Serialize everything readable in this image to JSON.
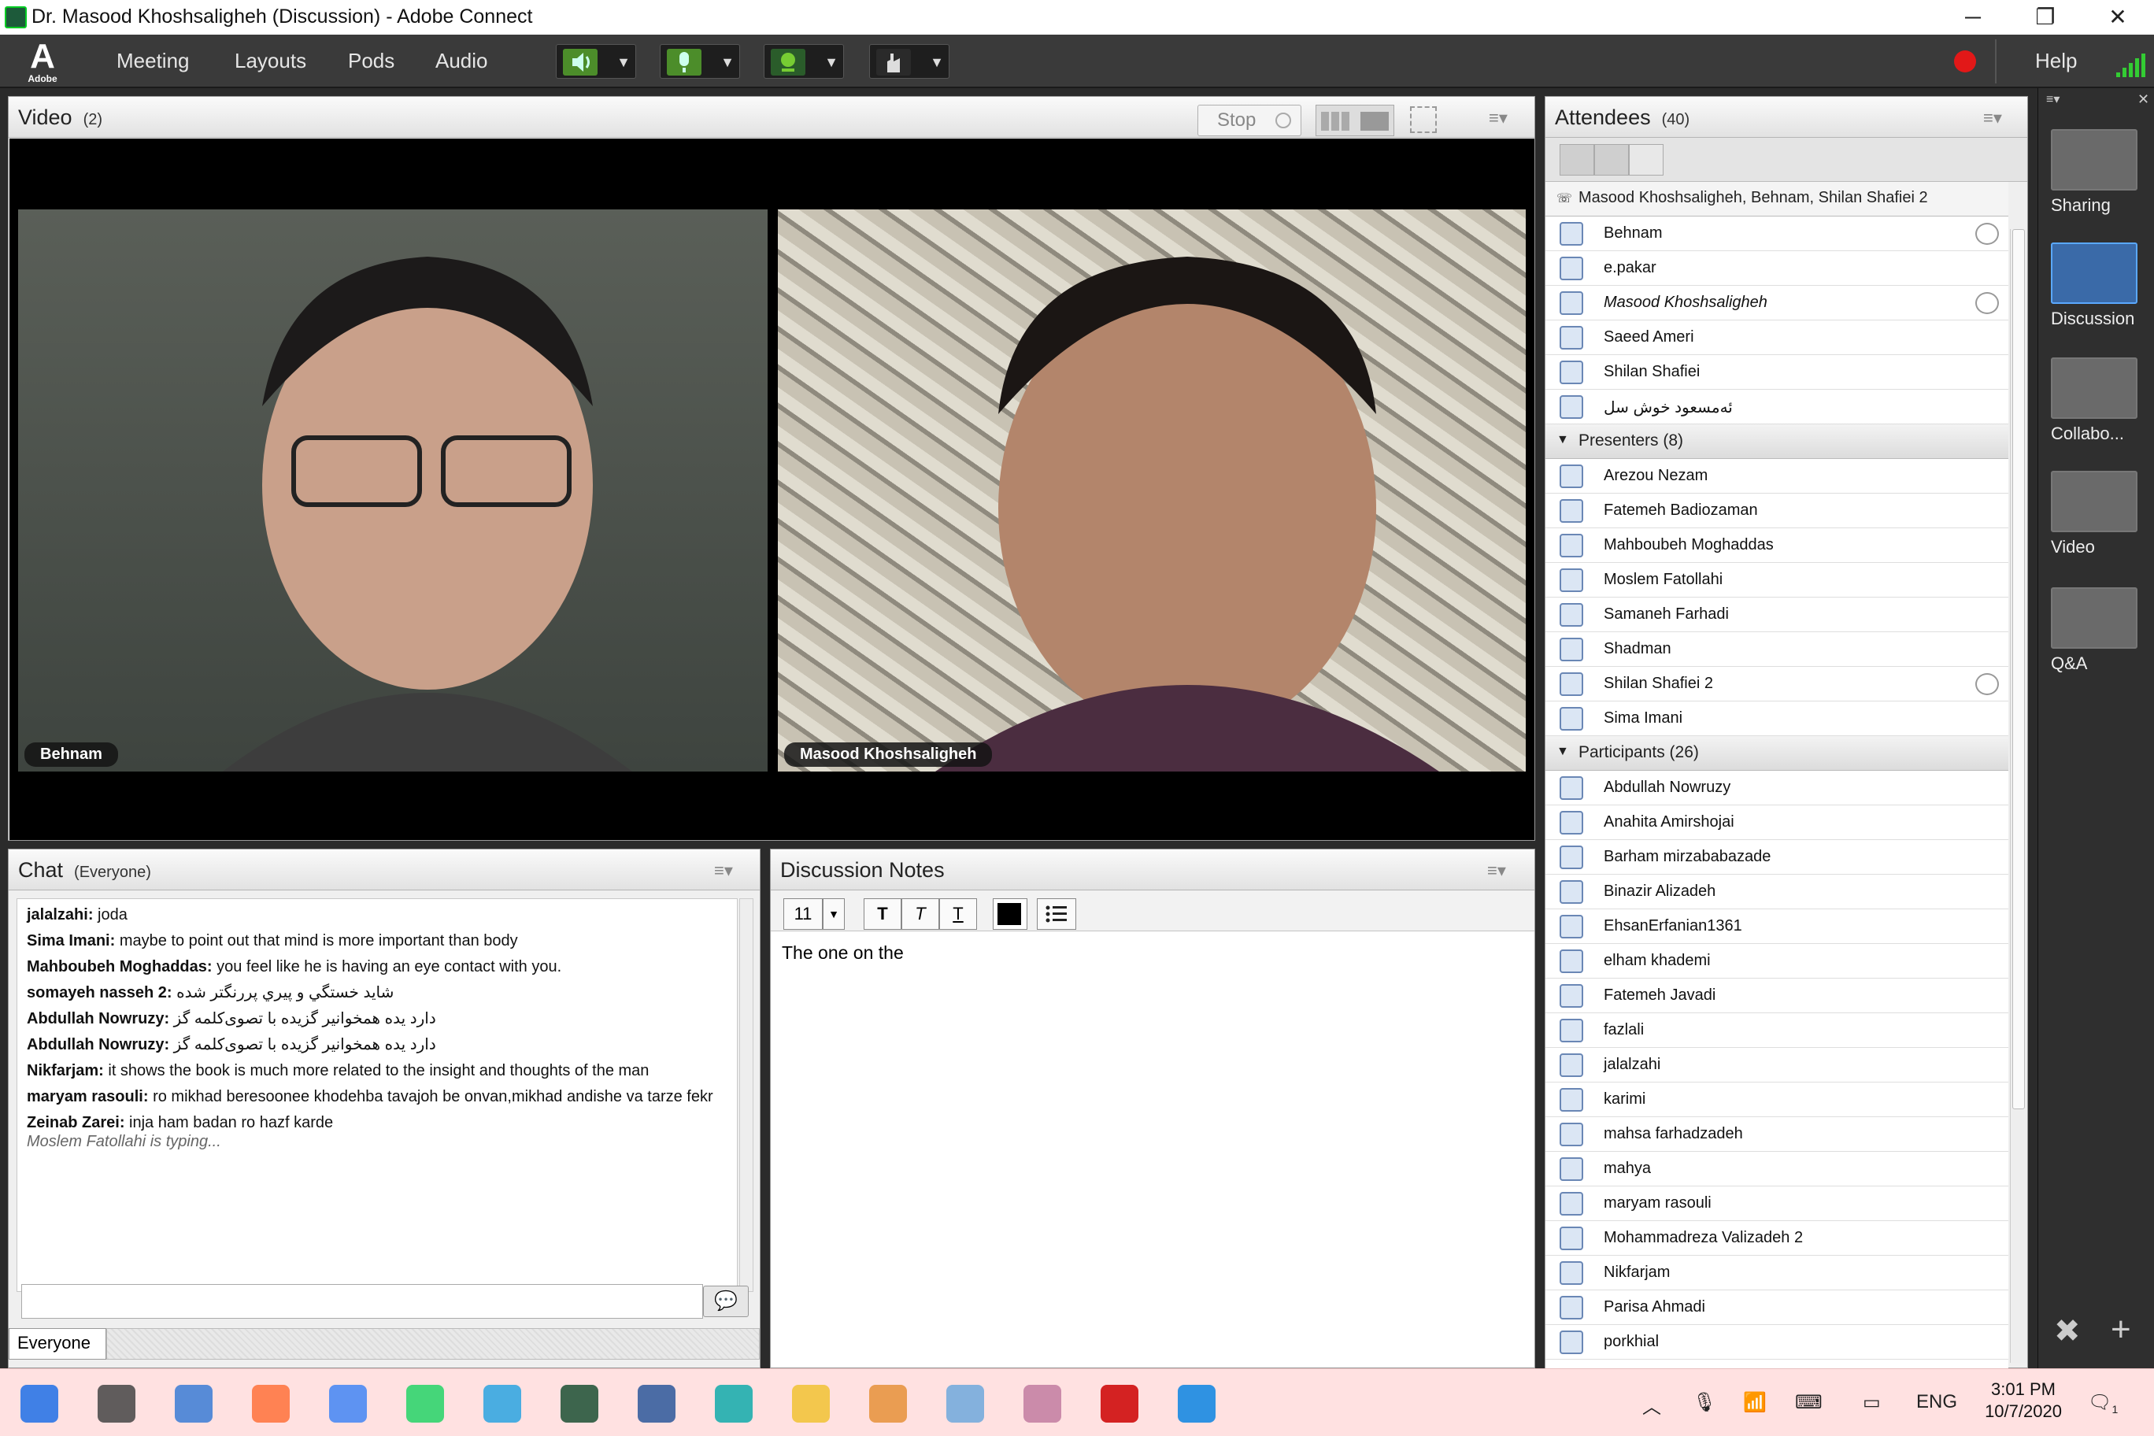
{
  "window": {
    "title": "Dr. Masood Khoshsaligheh (Discussion) - Adobe Connect",
    "min_glyph": "─",
    "restore_glyph": "❐",
    "close_glyph": "✕"
  },
  "menubar": {
    "logo_text": "Adobe",
    "items": [
      "Meeting",
      "Layouts",
      "Pods",
      "Audio"
    ],
    "help": "Help",
    "tool_icons": [
      "speaker-icon",
      "microphone-icon",
      "webcam-icon",
      "raise-hand-icon"
    ]
  },
  "video_pod": {
    "title": "Video",
    "count": "(2)",
    "stop_label": "Stop",
    "feeds": [
      {
        "label": "Behnam"
      },
      {
        "label": "Masood Khoshsaligheh"
      }
    ]
  },
  "chat_pod": {
    "title": "Chat",
    "scope": "(Everyone)",
    "messages": [
      {
        "sender": "jalalzahi:",
        "text": " joda"
      },
      {
        "sender": "Sima Imani:",
        "text": " maybe to point out that mind is more important than body"
      },
      {
        "sender": "Mahboubeh Moghaddas:",
        "text": " you feel like he is having an eye contact with you."
      },
      {
        "sender": "somayeh nasseh 2:",
        "text": " شاید خستگي و پيري پررنگتر شده"
      },
      {
        "sender": "Abdullah Nowruzy:",
        "text": " دارد یده همخوانیر گزیده با تصوی‌کلمه گز"
      },
      {
        "sender": "Abdullah Nowruzy:",
        "text": " دارد یده همخوانیر گزیده با تصوی‌کلمه گز"
      },
      {
        "sender": "Nikfarjam:",
        "text": " it shows the book is much more related to the insight and thoughts of the man"
      },
      {
        "sender": "maryam rasouli:",
        "text": "  ro mikhad beresoonee khodehba tavajoh be onvan,mikhad andishe va tarze fekr"
      },
      {
        "sender": "Zeinab Zarei:",
        "text": " inja ham badan ro hazf karde"
      }
    ],
    "typing": "Moslem Fatollahi is typing...",
    "input_value": "",
    "tab": "Everyone"
  },
  "notes_pod": {
    "title": "Discussion Notes",
    "font_size": "11",
    "format_buttons": [
      "T",
      "T",
      "T"
    ],
    "content": "The one on the"
  },
  "attendees_pod": {
    "title": "Attendees",
    "count": "(40)",
    "speaking": "Masood Khoshsaligheh, Behnam, Shilan Shafiei 2",
    "hosts": [
      {
        "name": "Behnam",
        "mic": true
      },
      {
        "name": "e.pakar",
        "mic": false
      },
      {
        "name": "Masood Khoshsaligheh",
        "mic": true,
        "italic": true
      },
      {
        "name": "Saeed Ameri",
        "mic": false
      },
      {
        "name": "Shilan Shafiei",
        "mic": false
      },
      {
        "name": "ئەمسعود خوش سل",
        "mic": false
      }
    ],
    "presenters_label": "Presenters (8)",
    "presenters": [
      {
        "name": "Arezou Nezam",
        "mic": false
      },
      {
        "name": "Fatemeh Badiozaman",
        "mic": false
      },
      {
        "name": "Mahboubeh Moghaddas",
        "mic": false
      },
      {
        "name": "Moslem Fatollahi",
        "mic": false
      },
      {
        "name": "Samaneh Farhadi",
        "mic": false
      },
      {
        "name": "Shadman",
        "mic": false
      },
      {
        "name": "Shilan Shafiei 2",
        "mic": true
      },
      {
        "name": "Sima Imani",
        "mic": false
      }
    ],
    "participants_label": "Participants (26)",
    "participants": [
      "Abdullah Nowruzy",
      "Anahita Amirshojai",
      "Barham mirzababazade",
      "Binazir Alizadeh",
      "EhsanErfanian1361",
      "elham khademi",
      "Fatemeh Javadi",
      "fazlali",
      "jalalzahi",
      "karimi",
      "mahsa farhadzadeh",
      "mahya",
      "maryam rasouli",
      "Mohammadreza Valizadeh 2",
      "Nikfarjam",
      "Parisa Ahmadi",
      "porkhial"
    ]
  },
  "layouts": [
    {
      "label": "Sharing",
      "selected": false
    },
    {
      "label": "Discussion",
      "selected": true
    },
    {
      "label": "Collabo...",
      "selected": false
    },
    {
      "label": "Video",
      "selected": false
    },
    {
      "label": "Q&A",
      "selected": false
    }
  ],
  "taskbar": {
    "lang": "ENG",
    "time": "3:01 PM",
    "date": "10/7/2020",
    "notification_count": "1",
    "pinned": [
      "windows-start-icon",
      "task-view-icon",
      "store-icon",
      "firefox-icon",
      "chrome-icon",
      "whatsapp-icon",
      "telegram-icon",
      "adobe-connect-icon",
      "word-icon",
      "app-icon",
      "file-explorer-icon",
      "pen-app-icon",
      "photos-app-icon",
      "paint-app-icon",
      "recorder-icon",
      "screen-app-icon"
    ]
  }
}
